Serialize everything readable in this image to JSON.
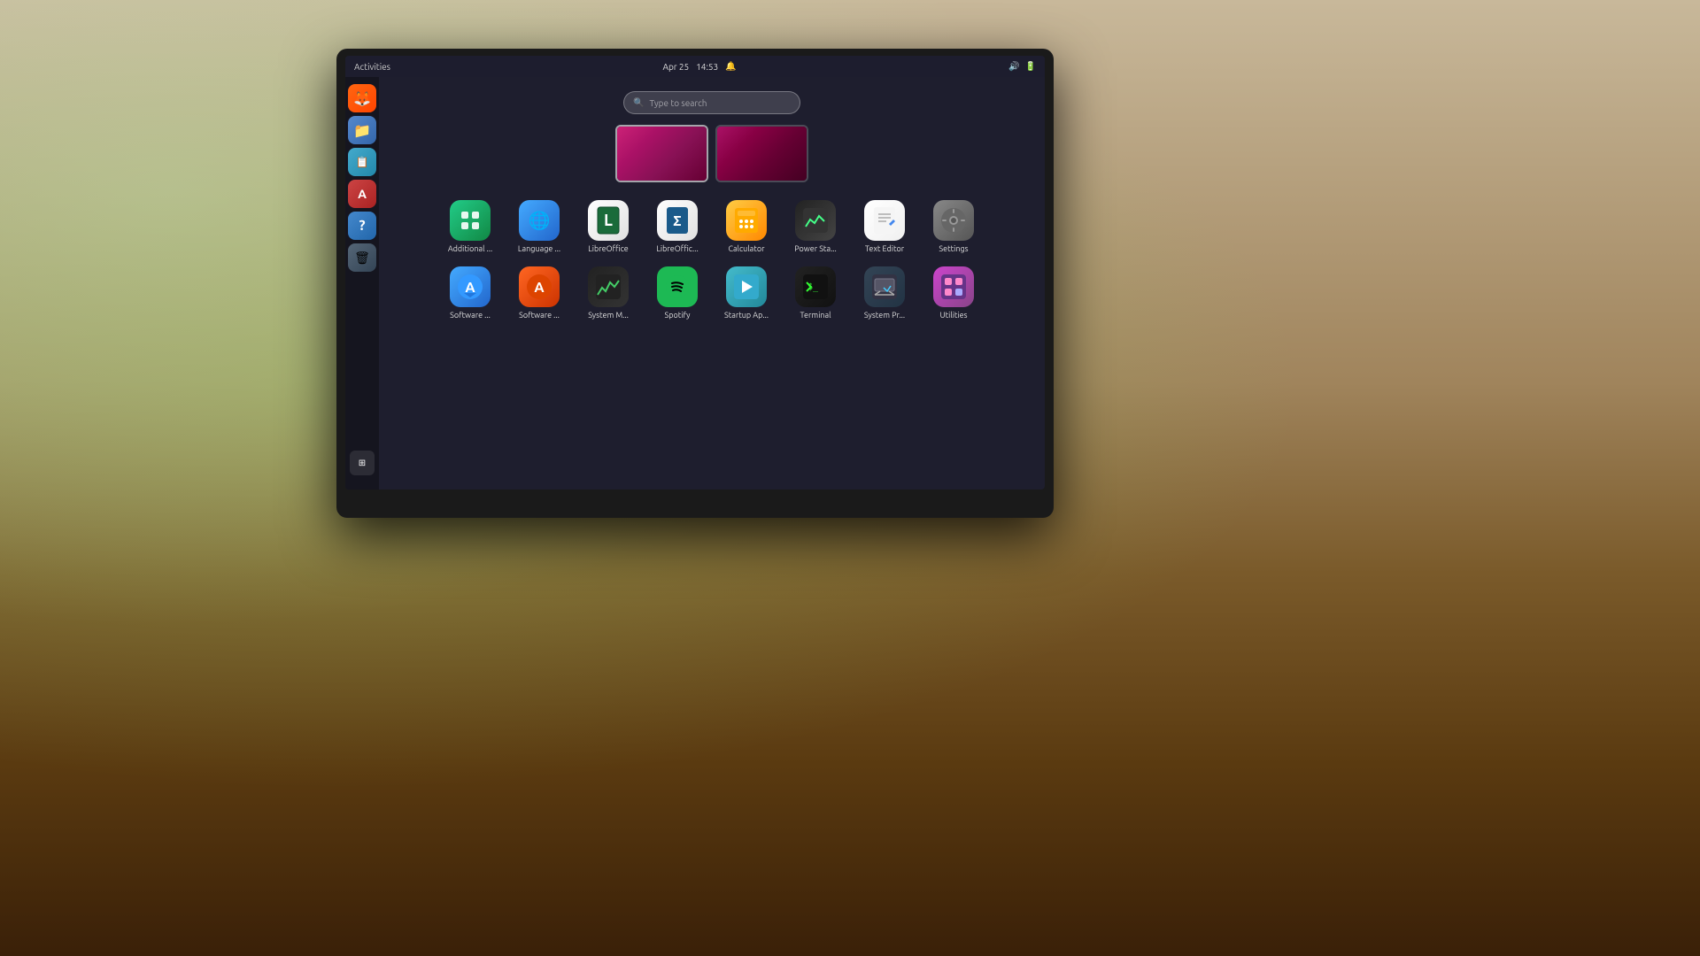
{
  "topbar": {
    "activities": "Activities",
    "date": "Apr 25",
    "time": "14:53",
    "sound_icon": "🔊",
    "battery_icon": "🔋"
  },
  "search": {
    "placeholder": "Type to search"
  },
  "sidebar": {
    "items": [
      {
        "id": "firefox",
        "label": "Firefox",
        "icon": "🦊"
      },
      {
        "id": "files",
        "label": "Files",
        "icon": "📁"
      },
      {
        "id": "manager",
        "label": "Files Manager",
        "icon": "📋"
      },
      {
        "id": "software",
        "label": "Software",
        "icon": "🅐"
      },
      {
        "id": "help",
        "label": "Help",
        "icon": "❓"
      },
      {
        "id": "trash",
        "label": "Trash",
        "icon": "🗑"
      }
    ],
    "grid_label": "Show Apps"
  },
  "apps": {
    "row1": [
      {
        "id": "additional",
        "label": "Additional ...",
        "icon_class": "icon-additional",
        "icon_char": "⚙"
      },
      {
        "id": "language",
        "label": "Language ...",
        "icon_class": "icon-language",
        "icon_char": "🌐"
      },
      {
        "id": "libreoffice",
        "label": "LibreOffice",
        "icon_class": "icon-libreoffice",
        "icon_char": "L"
      },
      {
        "id": "libreofficecalc",
        "label": "LibreOffic...",
        "icon_class": "icon-libreofficecalc",
        "icon_char": "L"
      },
      {
        "id": "calculator",
        "label": "Calculator",
        "icon_class": "icon-calculator",
        "icon_char": "🧮"
      },
      {
        "id": "powerstat",
        "label": "Power Sta...",
        "icon_class": "icon-powerstat",
        "icon_char": "📊"
      },
      {
        "id": "texteditor",
        "label": "Text Editor",
        "icon_class": "icon-texteditor",
        "icon_char": "✏"
      },
      {
        "id": "settings",
        "label": "Settings",
        "icon_class": "icon-settings",
        "icon_char": "⚙"
      }
    ],
    "row2": [
      {
        "id": "softwareup",
        "label": "Software ...",
        "icon_class": "icon-softwareup",
        "icon_char": "🅐"
      },
      {
        "id": "softwarecenter",
        "label": "Software ...",
        "icon_class": "icon-softwarecenter",
        "icon_char": "🅐"
      },
      {
        "id": "systemmonitor",
        "label": "System M...",
        "icon_class": "icon-systemmonitor",
        "icon_char": "📈"
      },
      {
        "id": "spotify",
        "label": "Spotify",
        "icon_class": "icon-spotify",
        "icon_char": "♫"
      },
      {
        "id": "startup",
        "label": "Startup Ap...",
        "icon_class": "icon-startup",
        "icon_char": "▶"
      },
      {
        "id": "terminal",
        "label": "Terminal",
        "icon_class": "icon-terminal",
        "icon_char": "$"
      },
      {
        "id": "systemprof",
        "label": "System Pr...",
        "icon_class": "icon-systemprof",
        "icon_char": "🖥"
      },
      {
        "id": "utilities",
        "label": "Utilities",
        "icon_class": "icon-utilities",
        "icon_char": "⊞"
      }
    ]
  }
}
